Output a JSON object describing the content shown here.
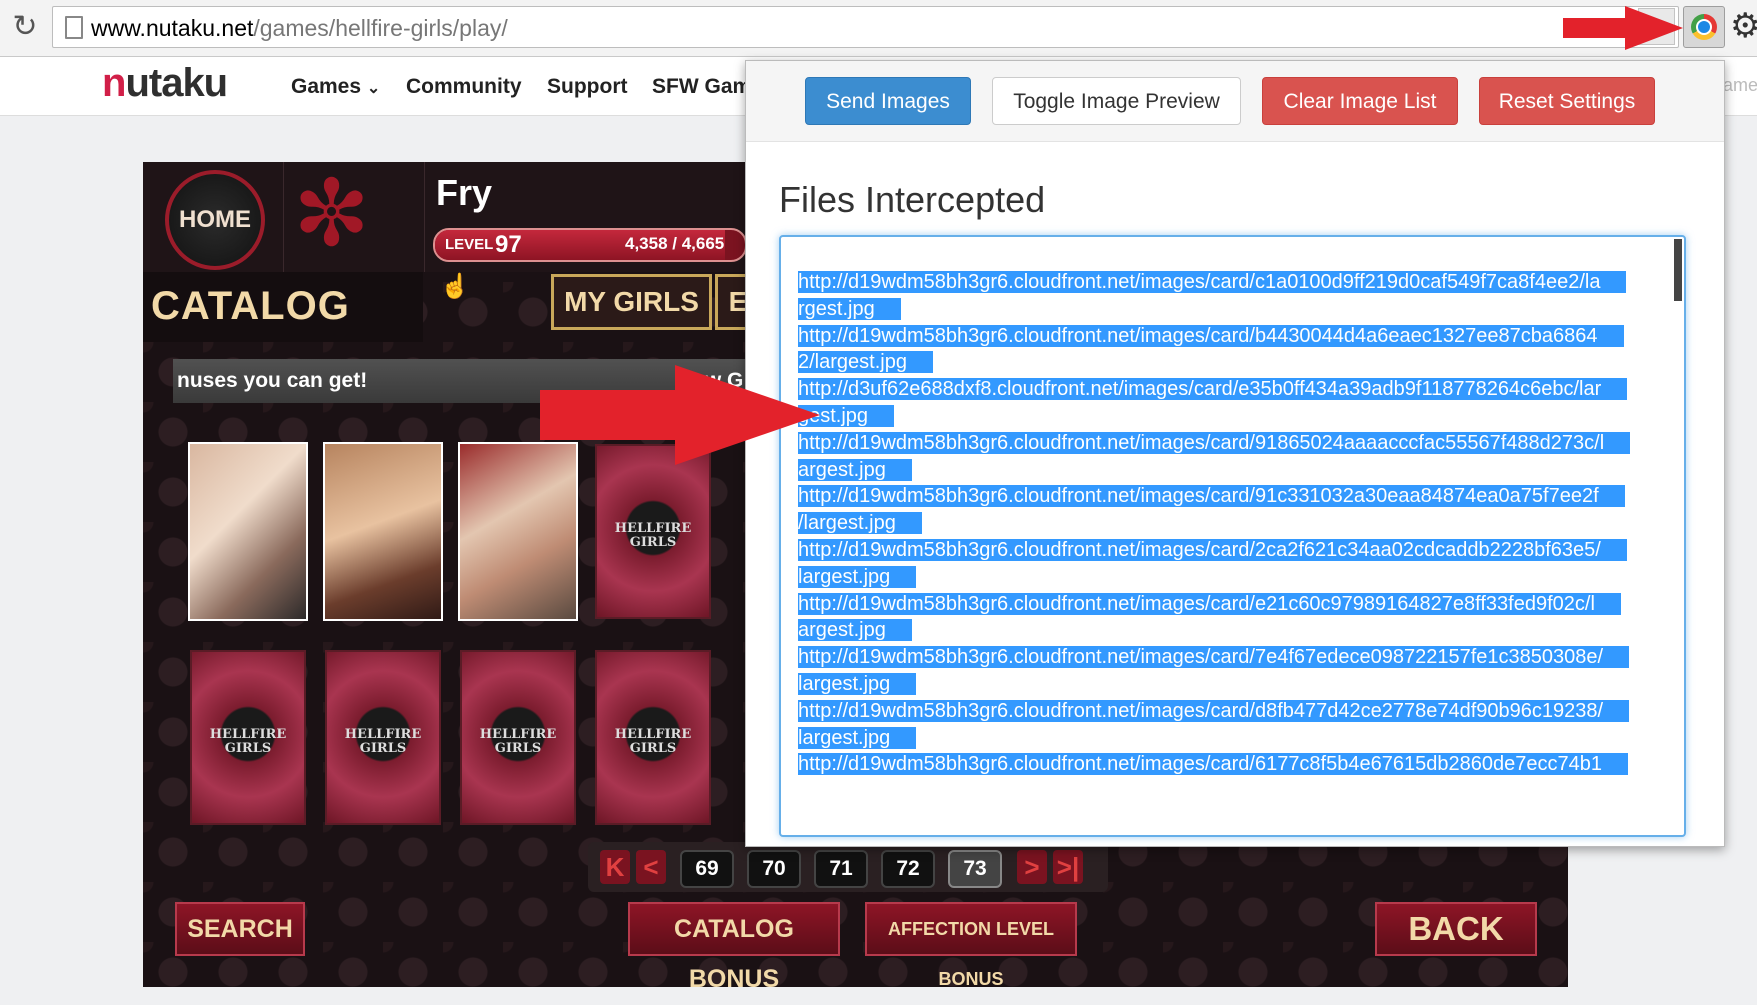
{
  "browser": {
    "url_host": "www.nutaku.net",
    "url_path": "/games/hellfire-girls/play/",
    "reload_icon": "reload-icon",
    "extension_icon": "chrome-extension-icon",
    "menu_icon": "gear-icon"
  },
  "site": {
    "logo_initial": "n",
    "logo_rest": "utaku",
    "nav": [
      "Games",
      "Community",
      "Support",
      "SFW Gam"
    ],
    "nav_tail": "ame"
  },
  "game": {
    "home_label": "HOME",
    "username": "Fry",
    "level_label": "LEVEL",
    "level": "97",
    "hp_text": "4,358 / 4,665",
    "hp_fraction": 0.934,
    "catalog_title": "CATALOG",
    "tabs": [
      "MY GIRLS",
      "E"
    ],
    "ticker_text": "nuses you can get!",
    "ticker_text2": "New G",
    "card_back_text": "HELLFIRE GIRLS",
    "pager": {
      "first": "K",
      "prev": "<",
      "pages": [
        "69",
        "70",
        "71",
        "72",
        "73"
      ],
      "active_page": "73",
      "next": ">",
      "last": ">|"
    },
    "buttons": {
      "search": "SEARCH",
      "catalog_bonus": "CATALOG BONUS",
      "affection_bonus": "AFFECTION LEVEL BONUS",
      "back": "BACK"
    }
  },
  "popup": {
    "buttons": {
      "send": "Send Images",
      "toggle": "Toggle Image Preview",
      "clear": "Clear Image List",
      "reset": "Reset Settings"
    },
    "title": "Files Intercepted",
    "lines": [
      "http://d19wdm58bh3gr6.cloudfront.net/images/card/c1a0100d9ff219d0caf549f7ca8f4ee2/la",
      "rgest.jpg",
      "http://d19wdm58bh3gr6.cloudfront.net/images/card/b4430044d4a6eaec1327ee87cba6864",
      "2/largest.jpg",
      "http://d3uf62e688dxf8.cloudfront.net/images/card/e35b0ff434a39adb9f118778264c6ebc/lar",
      "gest.jpg",
      "http://d19wdm58bh3gr6.cloudfront.net/images/card/91865024aaaacccfac55567f488d273c/l",
      "argest.jpg",
      "http://d19wdm58bh3gr6.cloudfront.net/images/card/91c331032a30eaa84874ea0a75f7ee2f",
      "/largest.jpg",
      "http://d19wdm58bh3gr6.cloudfront.net/images/card/2ca2f621c34aa02cdcaddb2228bf63e5/",
      "largest.jpg",
      "http://d19wdm58bh3gr6.cloudfront.net/images/card/e21c60c97989164827e8ff33fed9f02c/l",
      "argest.jpg",
      "http://d19wdm58bh3gr6.cloudfront.net/images/card/7e4f67edece098722157fe1c3850308e/",
      "largest.jpg",
      "http://d19wdm58bh3gr6.cloudfront.net/images/card/d8fb477d42ce2778e74df90b96c19238/",
      "largest.jpg",
      "http://d19wdm58bh3gr6.cloudfront.net/images/card/6177c8f5b4e67615db2860de7ecc74b1"
    ]
  },
  "colors": {
    "selection": "#3399ff",
    "primary": "#3c8dd0",
    "danger": "#d9534f",
    "arrow": "#e3222b",
    "brand": "#d11f48"
  }
}
